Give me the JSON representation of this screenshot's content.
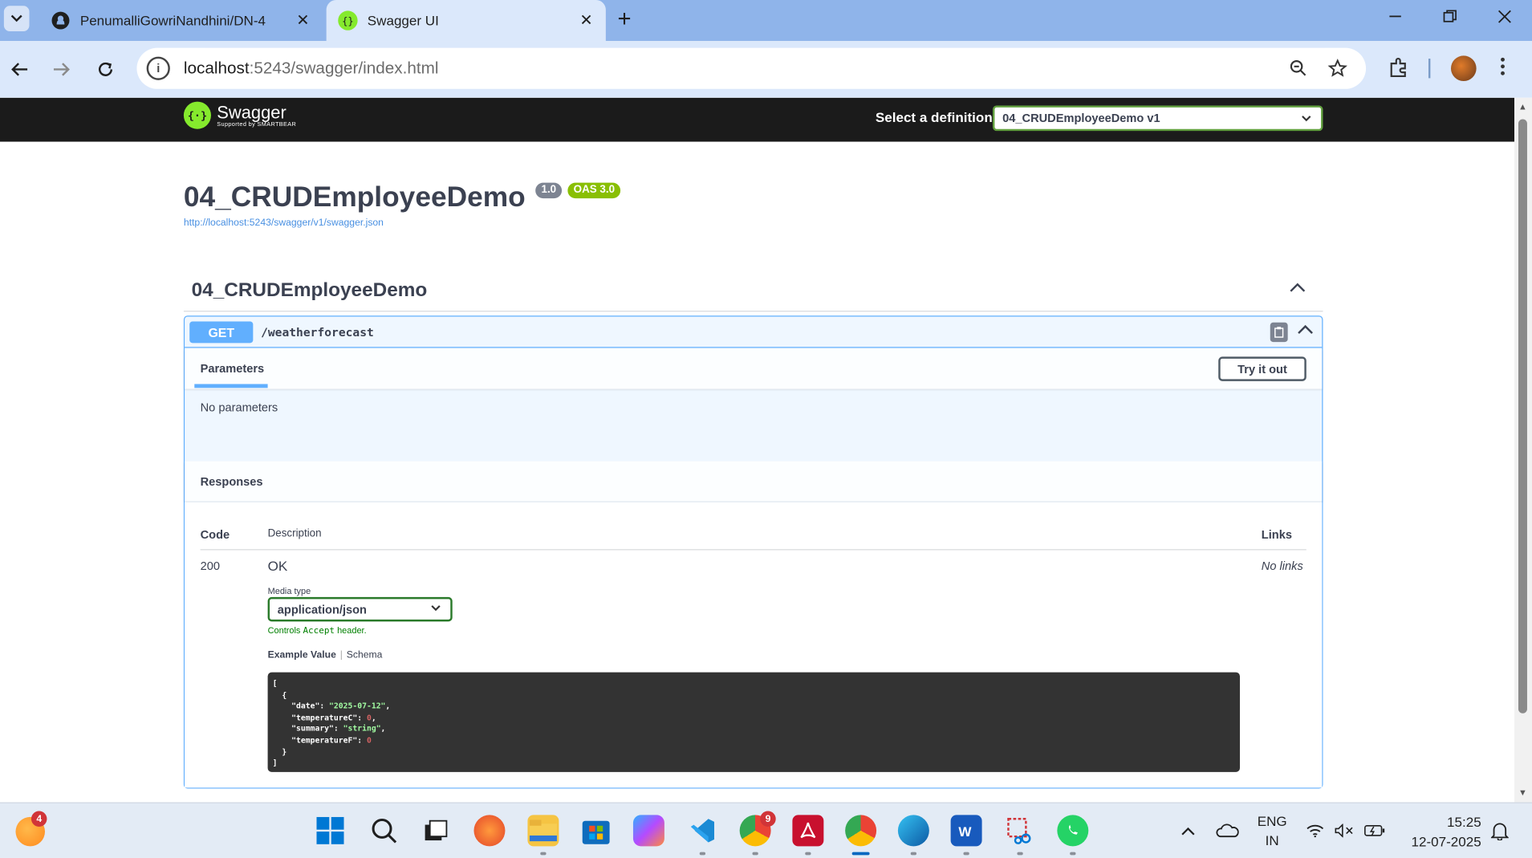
{
  "browser": {
    "tabs": [
      {
        "title": "PenumalliGowriNandhini/DN-4",
        "icon": "github-icon",
        "close": "✕"
      },
      {
        "title": "Swagger UI",
        "icon": "swagger-icon",
        "close": "✕"
      }
    ],
    "new_tab": "+",
    "url_host": "localhost",
    "url_rest": ":5243/swagger/index.html"
  },
  "swagger": {
    "brand": "Swagger",
    "brand_sub": "Supported by SMARTBEAR",
    "definition_label": "Select a definition",
    "definition_value": "04_CRUDEmployeeDemo v1",
    "title": "04_CRUDEmployeeDemo",
    "version": "1.0",
    "oas": "OAS 3.0",
    "spec_url": "http://localhost:5243/swagger/v1/swagger.json",
    "tag": "04_CRUDEmployeeDemo",
    "operation": {
      "method": "GET",
      "path": "/weatherforecast",
      "parameters_tab": "Parameters",
      "try_it_out": "Try it out",
      "no_parameters": "No parameters",
      "responses_title": "Responses",
      "headers": {
        "code": "Code",
        "description": "Description",
        "links": "Links"
      },
      "response": {
        "code": "200",
        "description": "OK",
        "links": "No links",
        "media_type_label": "Media type",
        "media_type": "application/json",
        "controls_note_pre": "Controls ",
        "controls_note_mono": "Accept",
        "controls_note_post": " header.",
        "example_tab": "Example Value",
        "schema_tab": "Schema",
        "example": {
          "date": "\"2025-07-12\"",
          "temperatureC": "0",
          "summary": "\"string\"",
          "temperatureF": "0"
        }
      }
    }
  },
  "taskbar": {
    "weather_badge": "4",
    "chrome_badge": "9",
    "lang_top": "ENG",
    "lang_bottom": "IN",
    "time": "15:25",
    "date": "12-07-2025"
  },
  "colors": {
    "get": "#61affe",
    "swagger_green": "#85ea2d",
    "topbar": "#1b1b1b"
  }
}
